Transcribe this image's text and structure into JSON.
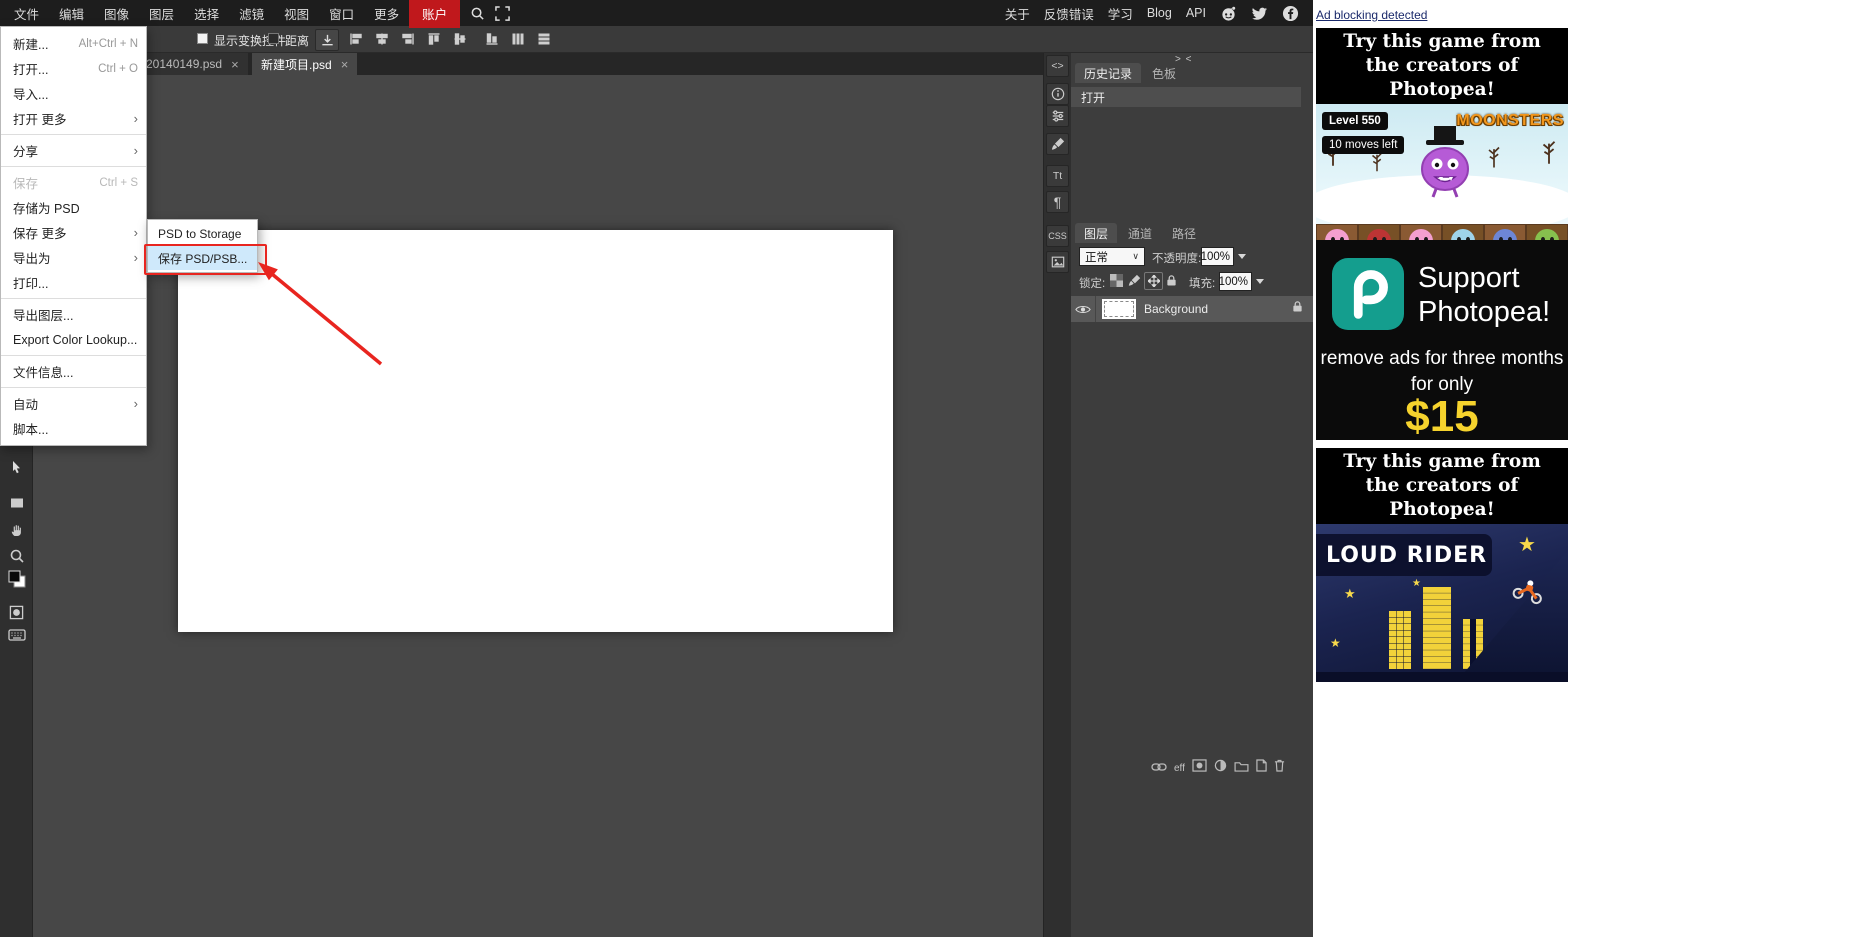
{
  "topbar": {
    "menus": [
      {
        "label": "文件"
      },
      {
        "label": "编辑"
      },
      {
        "label": "图像"
      },
      {
        "label": "图层"
      },
      {
        "label": "选择"
      },
      {
        "label": "滤镜"
      },
      {
        "label": "视图"
      },
      {
        "label": "窗口"
      },
      {
        "label": "更多"
      },
      {
        "label": "账户"
      }
    ],
    "links": [
      "关于",
      "反馈错误",
      "学习",
      "Blog",
      "API"
    ]
  },
  "options_bar": {
    "show_transform": "显示变换控件",
    "distance": "距离"
  },
  "tabs": [
    {
      "label": "20140149.psd"
    },
    {
      "label": "新建项目.psd"
    }
  ],
  "file_menu": {
    "items": [
      {
        "label": "新建...",
        "shortcut": "Alt+Ctrl + N"
      },
      {
        "label": "打开...",
        "shortcut": "Ctrl + O"
      },
      {
        "label": "导入..."
      },
      {
        "label": "打开 更多",
        "submenu": true
      },
      {
        "label": "分享",
        "submenu": true
      },
      {
        "label": "保存",
        "shortcut": "Ctrl + S",
        "disabled": true
      },
      {
        "label": "存储为 PSD"
      },
      {
        "label": "保存 更多",
        "submenu": true
      },
      {
        "label": "导出为",
        "submenu": true
      },
      {
        "label": "打印..."
      },
      {
        "label": "导出图层..."
      },
      {
        "label": "Export Color Lookup..."
      },
      {
        "label": "文件信息..."
      },
      {
        "label": "自动",
        "submenu": true
      },
      {
        "label": "脚本..."
      }
    ]
  },
  "submenu": {
    "items": [
      {
        "label": "PSD to Storage"
      },
      {
        "label": "保存 PSD/PSB...",
        "highlighted": true
      }
    ]
  },
  "panels": {
    "collapse": "> <",
    "history": {
      "tabs": [
        "历史记录",
        "色板"
      ],
      "entries": [
        "打开"
      ]
    },
    "layers": {
      "tabs": [
        "图层",
        "通道",
        "路径"
      ],
      "blend_mode": "正常",
      "opacity_label": "不透明度:",
      "opacity": "100%",
      "lock_label": "锁定:",
      "fill_label": "填充:",
      "fill": "100%",
      "layer_name": "Background",
      "eff": "eff"
    },
    "strip": {
      "code": "<>",
      "text_tool": "Tt",
      "paragraph": "¶",
      "css": "CSS"
    }
  },
  "ads": {
    "notice": "Ad blocking detected",
    "game_header": {
      "line1": "Try this game from",
      "line2": "the creators of Photopea!"
    },
    "moonsters": {
      "level": "Level 550",
      "moves": "10 moves left",
      "title": "MOONSTERS"
    },
    "support": {
      "line1": "Support",
      "line2": "Photopea!",
      "body1": "remove ads for three months",
      "body2": "for only",
      "price": "$15"
    },
    "cloud_rider": {
      "title": "LOUD RIDER"
    }
  },
  "colors": {
    "accent_red": "#c0181c",
    "annotation_red": "#e8251f",
    "menu_highlight": "#cfe9fb",
    "price_yellow": "#f6d32d",
    "moonsters_orange": "#f2971d",
    "photopea_green": "#149e8e"
  }
}
